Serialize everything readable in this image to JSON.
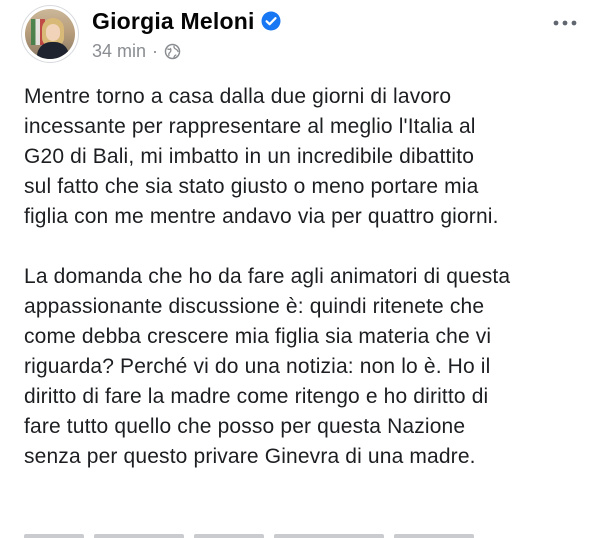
{
  "post": {
    "author": "Giorgia Meloni",
    "verified_icon": "verified-badge-icon",
    "timestamp": "34 min",
    "separator": "·",
    "audience_icon": "globe-icon",
    "more_icon": "more-options-icon",
    "paragraphs": [
      "Mentre torno a casa dalla due giorni di lavoro\nincessante per rappresentare al meglio l'Italia al\nG20 di Bali, mi imbatto in un incredibile dibattito\nsul fatto che sia stato giusto o meno portare mia\nfiglia con me mentre andavo via per quattro giorni.",
      "La domanda che ho da fare agli animatori di questa\nappassionante discussione è: quindi ritenete che\ncome debba crescere mia figlia sia materia che vi\nriguarda? Perché vi do una notizia: non lo è. Ho il\ndiritto di fare la madre come ritengo e ho diritto di\nfare tutto quello che posso per questa Nazione\nsenza per questo privare Ginevra di una madre."
    ]
  },
  "colors": {
    "verified_blue": "#1877f2",
    "meta_gray": "#8a8d91",
    "text": "#1c1e21"
  }
}
